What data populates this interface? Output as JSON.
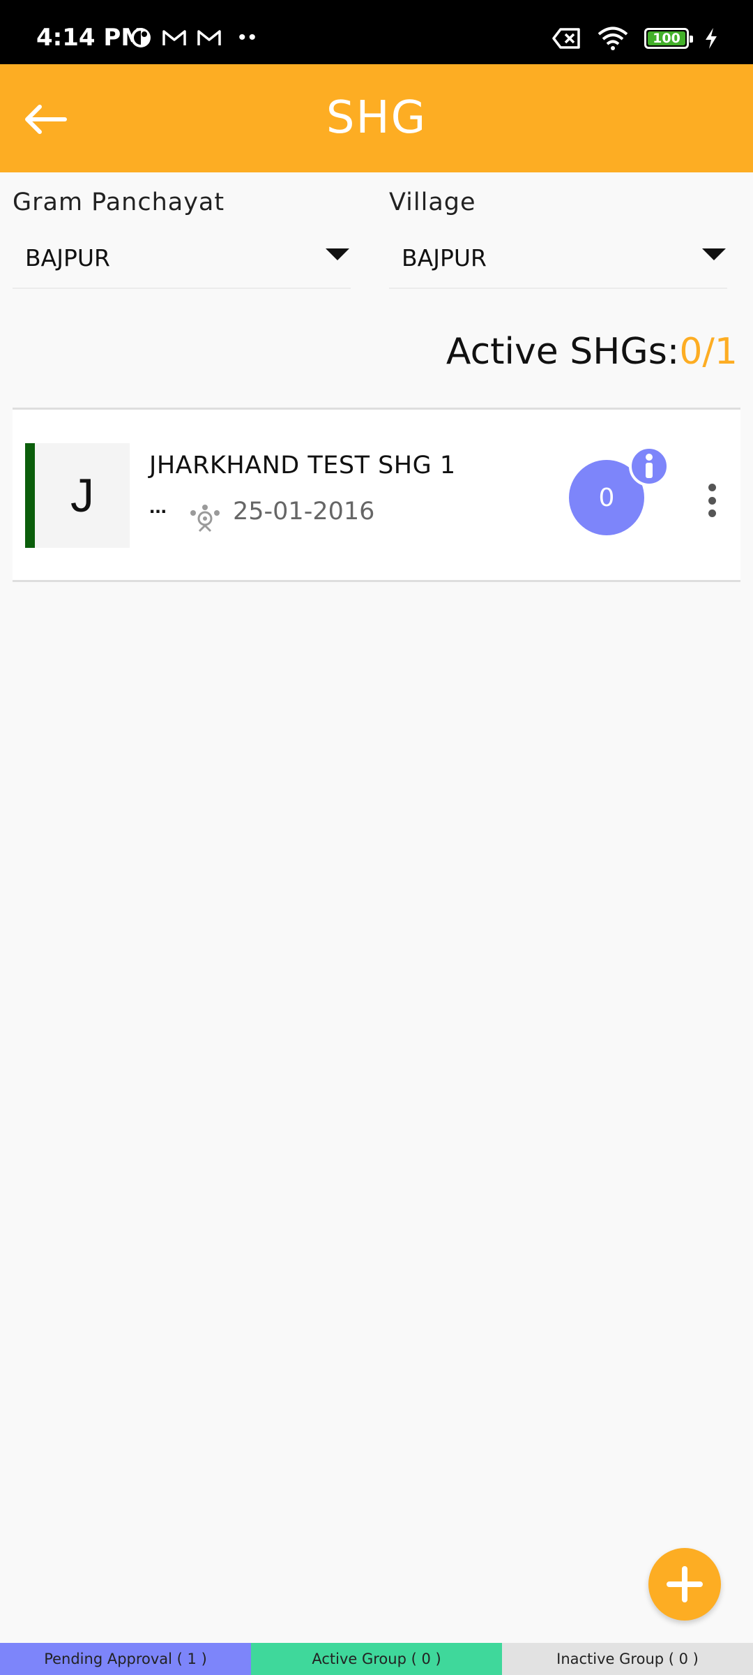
{
  "status_bar": {
    "time": "4:14 PM",
    "battery": "100",
    "icons": [
      "notification-badge-icon",
      "gmail-icon",
      "gmail-icon",
      "more-notifications-icon",
      "no-sim-icon",
      "wifi-icon",
      "battery-icon",
      "charging-icon"
    ]
  },
  "header": {
    "title": "SHG",
    "back_icon": "arrow-left-icon",
    "background_color": "#fdad23"
  },
  "filters": {
    "gram_panchayat": {
      "label": "Gram Panchayat",
      "value": "BAJPUR"
    },
    "village": {
      "label": "Village",
      "value": "BAJPUR"
    }
  },
  "summary": {
    "label": "Active SHGs:",
    "value": "0/1",
    "value_color": "#fdad23"
  },
  "shg_list": [
    {
      "initial": "J",
      "name": "JHARKHAND TEST SHG 1",
      "sub": "...",
      "date": "25-01-2016",
      "count": "0",
      "status_color": "#0b5e0b"
    }
  ],
  "fab": {
    "icon": "plus-icon"
  },
  "tabs": [
    {
      "label": "Pending Approval ( 1 )",
      "color": "#7d85fa"
    },
    {
      "label": "Active Group ( 0 )",
      "color": "#3fd89b"
    },
    {
      "label": "Inactive Group ( 0 )",
      "color": "#e2e2e2"
    }
  ]
}
